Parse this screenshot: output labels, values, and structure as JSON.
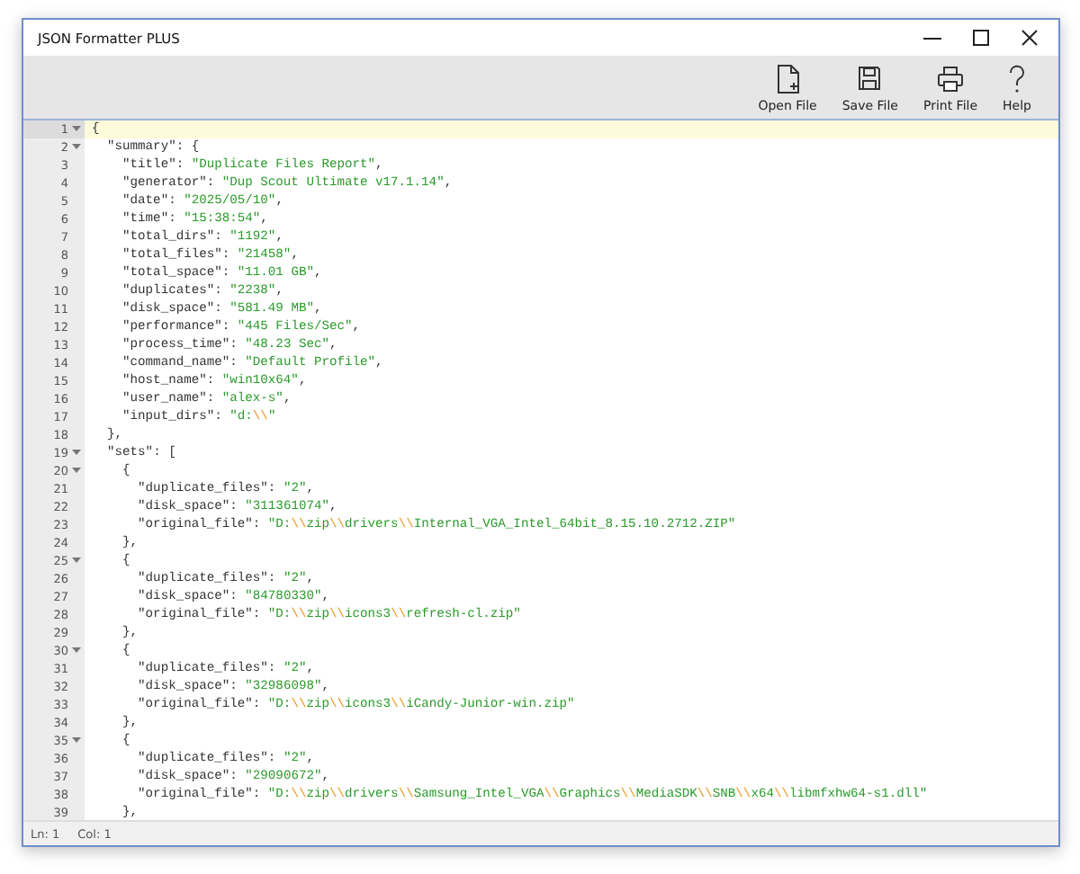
{
  "window": {
    "title": "JSON Formatter PLUS"
  },
  "toolbar": [
    {
      "label": "Open File",
      "kind": "open"
    },
    {
      "label": "Save File",
      "kind": "save"
    },
    {
      "label": "Print File",
      "kind": "print"
    },
    {
      "label": "Help",
      "kind": "help"
    }
  ],
  "editor": {
    "lines": [
      {
        "number": "1",
        "text": "{",
        "fold": true,
        "current": true
      },
      {
        "number": "2",
        "text": "  \"summary\": {",
        "fold": true,
        "current": false
      },
      {
        "number": "3",
        "text": "    \"title\": \"Duplicate Files Report\",",
        "fold": false,
        "current": false
      },
      {
        "number": "4",
        "text": "    \"generator\": \"Dup Scout Ultimate v17.1.14\",",
        "fold": false,
        "current": false
      },
      {
        "number": "5",
        "text": "    \"date\": \"2025/05/10\",",
        "fold": false,
        "current": false
      },
      {
        "number": "6",
        "text": "    \"time\": \"15:38:54\",",
        "fold": false,
        "current": false
      },
      {
        "number": "7",
        "text": "    \"total_dirs\": \"1192\",",
        "fold": false,
        "current": false
      },
      {
        "number": "8",
        "text": "    \"total_files\": \"21458\",",
        "fold": false,
        "current": false
      },
      {
        "number": "9",
        "text": "    \"total_space\": \"11.01 GB\",",
        "fold": false,
        "current": false
      },
      {
        "number": "10",
        "text": "    \"duplicates\": \"2238\",",
        "fold": false,
        "current": false
      },
      {
        "number": "11",
        "text": "    \"disk_space\": \"581.49 MB\",",
        "fold": false,
        "current": false
      },
      {
        "number": "12",
        "text": "    \"performance\": \"445 Files/Sec\",",
        "fold": false,
        "current": false
      },
      {
        "number": "13",
        "text": "    \"process_time\": \"48.23 Sec\",",
        "fold": false,
        "current": false
      },
      {
        "number": "14",
        "text": "    \"command_name\": \"Default Profile\",",
        "fold": false,
        "current": false
      },
      {
        "number": "15",
        "text": "    \"host_name\": \"win10x64\",",
        "fold": false,
        "current": false
      },
      {
        "number": "16",
        "text": "    \"user_name\": \"alex-s\",",
        "fold": false,
        "current": false
      },
      {
        "number": "17",
        "text": "    \"input_dirs\": \"d:\\\\\"",
        "fold": false,
        "current": false
      },
      {
        "number": "18",
        "text": "  },",
        "fold": false,
        "current": false
      },
      {
        "number": "19",
        "text": "  \"sets\": [",
        "fold": true,
        "current": false
      },
      {
        "number": "20",
        "text": "    {",
        "fold": true,
        "current": false
      },
      {
        "number": "21",
        "text": "      \"duplicate_files\": \"2\",",
        "fold": false,
        "current": false
      },
      {
        "number": "22",
        "text": "      \"disk_space\": \"311361074\",",
        "fold": false,
        "current": false
      },
      {
        "number": "23",
        "text": "      \"original_file\": \"D:\\\\zip\\\\drivers\\\\Internal_VGA_Intel_64bit_8.15.10.2712.ZIP\"",
        "fold": false,
        "current": false
      },
      {
        "number": "24",
        "text": "    },",
        "fold": false,
        "current": false
      },
      {
        "number": "25",
        "text": "    {",
        "fold": true,
        "current": false
      },
      {
        "number": "26",
        "text": "      \"duplicate_files\": \"2\",",
        "fold": false,
        "current": false
      },
      {
        "number": "27",
        "text": "      \"disk_space\": \"84780330\",",
        "fold": false,
        "current": false
      },
      {
        "number": "28",
        "text": "      \"original_file\": \"D:\\\\zip\\\\icons3\\\\refresh-cl.zip\"",
        "fold": false,
        "current": false
      },
      {
        "number": "29",
        "text": "    },",
        "fold": false,
        "current": false
      },
      {
        "number": "30",
        "text": "    {",
        "fold": true,
        "current": false
      },
      {
        "number": "31",
        "text": "      \"duplicate_files\": \"2\",",
        "fold": false,
        "current": false
      },
      {
        "number": "32",
        "text": "      \"disk_space\": \"32986098\",",
        "fold": false,
        "current": false
      },
      {
        "number": "33",
        "text": "      \"original_file\": \"D:\\\\zip\\\\icons3\\\\iCandy-Junior-win.zip\"",
        "fold": false,
        "current": false
      },
      {
        "number": "34",
        "text": "    },",
        "fold": false,
        "current": false
      },
      {
        "number": "35",
        "text": "    {",
        "fold": true,
        "current": false
      },
      {
        "number": "36",
        "text": "      \"duplicate_files\": \"2\",",
        "fold": false,
        "current": false
      },
      {
        "number": "37",
        "text": "      \"disk_space\": \"29090672\",",
        "fold": false,
        "current": false
      },
      {
        "number": "38",
        "text": "      \"original_file\": \"D:\\\\zip\\\\drivers\\\\Samsung_Intel_VGA\\\\Graphics\\\\MediaSDK\\\\SNB\\\\x64\\\\libmfxhw64-s1.dll\"",
        "fold": false,
        "current": false
      },
      {
        "number": "39",
        "text": "    },",
        "fold": false,
        "current": false
      }
    ]
  },
  "status_bar": {
    "line": "Ln: 1",
    "column": "Col: 1"
  }
}
